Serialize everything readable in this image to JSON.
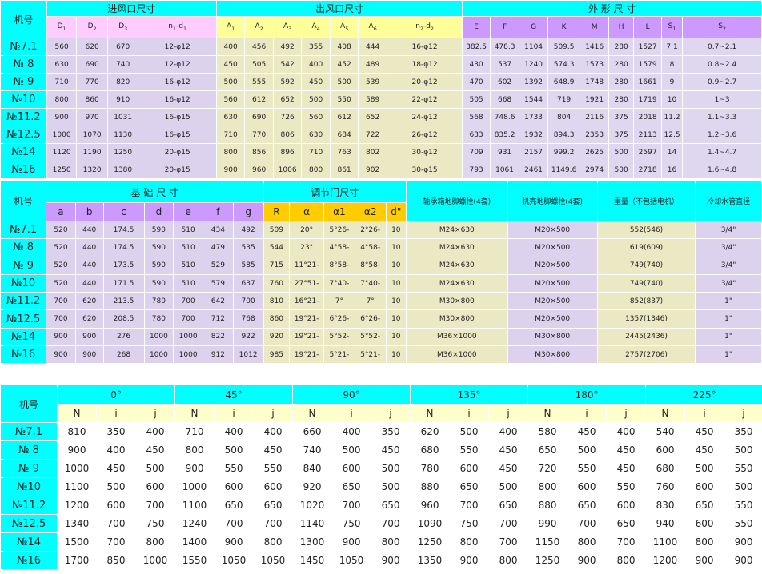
{
  "table1": {
    "model_label": "机号",
    "group_in": "进风口尺寸",
    "group_out": "出风口尺寸",
    "group_ext": "外 形 尺 寸",
    "sub_in": [
      "D1",
      "D2",
      "D3",
      "n1-d1"
    ],
    "sub_out": [
      "A1",
      "A2",
      "A3",
      "A4",
      "A5",
      "A6",
      "n2-d2"
    ],
    "sub_ext": [
      "E",
      "F",
      "G",
      "K",
      "M",
      "H",
      "L",
      "S1",
      "S2"
    ],
    "rows": [
      [
        "№7.1",
        "560",
        "620",
        "670",
        "12-φ12",
        "400",
        "456",
        "492",
        "355",
        "408",
        "444",
        "16-φ12",
        "382.5",
        "478.3",
        "1104",
        "509.5",
        "1416",
        "280",
        "1527",
        "7.1",
        "0.7~2.1"
      ],
      [
        "№ 8",
        "630",
        "690",
        "740",
        "12-φ12",
        "450",
        "505",
        "542",
        "400",
        "452",
        "489",
        "18-φ12",
        "430",
        "537",
        "1240",
        "574.3",
        "1573",
        "280",
        "1579",
        "8",
        "0.8~2.4"
      ],
      [
        "№ 9",
        "710",
        "770",
        "820",
        "16-φ12",
        "500",
        "555",
        "592",
        "450",
        "500",
        "539",
        "20-φ12",
        "470",
        "602",
        "1392",
        "648.9",
        "1748",
        "280",
        "1661",
        "9",
        "0.9~2.7"
      ],
      [
        "№10",
        "800",
        "860",
        "910",
        "16-φ12",
        "560",
        "612",
        "652",
        "500",
        "550",
        "589",
        "22-φ12",
        "505",
        "668",
        "1544",
        "719",
        "1921",
        "280",
        "1719",
        "10",
        "1~3"
      ],
      [
        "№11.2",
        "900",
        "970",
        "1031",
        "16-φ15",
        "630",
        "690",
        "726",
        "560",
        "612",
        "652",
        "24-φ12",
        "568",
        "748.6",
        "1733",
        "804",
        "2116",
        "375",
        "2018",
        "11.2",
        "1.1~3.3"
      ],
      [
        "№12.5",
        "1000",
        "1070",
        "1130",
        "16-φ15",
        "710",
        "770",
        "806",
        "630",
        "684",
        "722",
        "26-φ12",
        "633",
        "835.2",
        "1932",
        "894.3",
        "2353",
        "375",
        "2113",
        "12.5",
        "1.2~3.6"
      ],
      [
        "№14",
        "1120",
        "1190",
        "1250",
        "20-φ15",
        "800",
        "856",
        "896",
        "710",
        "763",
        "802",
        "30-φ12",
        "709",
        "931",
        "2157",
        "999.2",
        "2625",
        "500",
        "2597",
        "14",
        "1.4~4.7"
      ],
      [
        "№16",
        "1250",
        "1320",
        "1380",
        "20-φ15",
        "900",
        "960",
        "1006",
        "800",
        "861",
        "902",
        "30-φ15",
        "793",
        "1061",
        "2461",
        "1149.6",
        "2974",
        "500",
        "2718",
        "16",
        "1.6~4.8"
      ]
    ]
  },
  "table2": {
    "model_label": "机号",
    "group_base": "基 础 尺 寸",
    "group_damper": "调节门尺寸",
    "col_bearing": "轴承箱地脚螺栓(4套)",
    "col_casing": "机壳地脚螺栓(4套)",
    "col_weight": "重量（不包括电机）",
    "col_cooling": "冷却水管直径",
    "sub_base": [
      "a",
      "b",
      "c",
      "d",
      "e",
      "f",
      "g"
    ],
    "sub_damper": [
      "R",
      "α",
      "α1",
      "α2",
      "d\""
    ],
    "rows": [
      [
        "№7.1",
        "520",
        "440",
        "174.5",
        "590",
        "510",
        "434",
        "492",
        "509",
        "20°",
        "5°26-",
        "2°26-",
        "10",
        "M24×630",
        "M20×500",
        "552(546)",
        "3/4\""
      ],
      [
        "№ 8",
        "520",
        "440",
        "174.5",
        "590",
        "510",
        "479",
        "535",
        "544",
        "23°",
        "4°58-",
        "4°58-",
        "10",
        "M24×630",
        "M20×500",
        "619(609)",
        "3/4\""
      ],
      [
        "№ 9",
        "520",
        "440",
        "173.5",
        "590",
        "510",
        "529",
        "585",
        "715",
        "11°21-",
        "8°58-",
        "8°58-",
        "10",
        "M24×630",
        "M20×500",
        "749(740)",
        "3/4\""
      ],
      [
        "№10",
        "520",
        "440",
        "171.5",
        "590",
        "510",
        "579",
        "637",
        "760",
        "27°51-",
        "7°40-",
        "7°40-",
        "10",
        "M24×630",
        "M20×500",
        "749(740)",
        "3/4\""
      ],
      [
        "№11.2",
        "700",
        "620",
        "213.5",
        "780",
        "700",
        "642",
        "700",
        "810",
        "16°21-",
        "7°",
        "7°",
        "10",
        "M30×800",
        "M20×500",
        "852(837)",
        "1\""
      ],
      [
        "№12.5",
        "700",
        "620",
        "208.5",
        "780",
        "700",
        "712",
        "768",
        "860",
        "19°21-",
        "6°26-",
        "6°26-",
        "10",
        "M30×800",
        "M20×500",
        "1357(1346)",
        "1\""
      ],
      [
        "№14",
        "900",
        "900",
        "276",
        "1000",
        "1000",
        "822",
        "922",
        "920",
        "19°21-",
        "5°52-",
        "5°52-",
        "10",
        "M36×1000",
        "M30×800",
        "2445(2436)",
        "1\""
      ],
      [
        "№16",
        "900",
        "900",
        "268",
        "1000",
        "1000",
        "912",
        "1012",
        "985",
        "19°21-",
        "5°21-",
        "5°21-",
        "10",
        "M36×1000",
        "M30×800",
        "2757(2706)",
        "1\""
      ]
    ]
  },
  "table3": {
    "model_label": "机号",
    "angles": [
      "0°",
      "45°",
      "90°",
      "135°",
      "180°",
      "225°"
    ],
    "sub": [
      "N",
      "i",
      "j"
    ],
    "rows": [
      [
        "№7.1",
        "810",
        "350",
        "400",
        "710",
        "400",
        "400",
        "660",
        "400",
        "350",
        "620",
        "500",
        "400",
        "580",
        "450",
        "400",
        "540",
        "450",
        "350"
      ],
      [
        "№ 8",
        "900",
        "400",
        "450",
        "800",
        "500",
        "450",
        "740",
        "500",
        "450",
        "680",
        "550",
        "450",
        "650",
        "500",
        "450",
        "600",
        "450",
        "500"
      ],
      [
        "№ 9",
        "1000",
        "450",
        "500",
        "900",
        "550",
        "550",
        "840",
        "600",
        "500",
        "780",
        "600",
        "450",
        "720",
        "550",
        "450",
        "680",
        "500",
        "550"
      ],
      [
        "№10",
        "1100",
        "500",
        "600",
        "1000",
        "600",
        "600",
        "920",
        "650",
        "500",
        "880",
        "650",
        "500",
        "800",
        "600",
        "550",
        "760",
        "600",
        "500"
      ],
      [
        "№11.2",
        "1200",
        "600",
        "700",
        "1100",
        "650",
        "650",
        "1020",
        "700",
        "650",
        "960",
        "700",
        "650",
        "880",
        "650",
        "600",
        "830",
        "650",
        "550"
      ],
      [
        "№12.5",
        "1340",
        "700",
        "750",
        "1240",
        "700",
        "700",
        "1140",
        "750",
        "700",
        "1090",
        "750",
        "700",
        "990",
        "700",
        "650",
        "940",
        "600",
        "550"
      ],
      [
        "№14",
        "1500",
        "700",
        "800",
        "1400",
        "900",
        "800",
        "1300",
        "900",
        "800",
        "1250",
        "800",
        "700",
        "1150",
        "800",
        "700",
        "1100",
        "800",
        "900"
      ],
      [
        "№16",
        "1700",
        "850",
        "1000",
        "1550",
        "1050",
        "1050",
        "1450",
        "1050",
        "900",
        "1350",
        "900",
        "800",
        "1250",
        "900",
        "800",
        "1200",
        "900",
        "900"
      ]
    ]
  }
}
